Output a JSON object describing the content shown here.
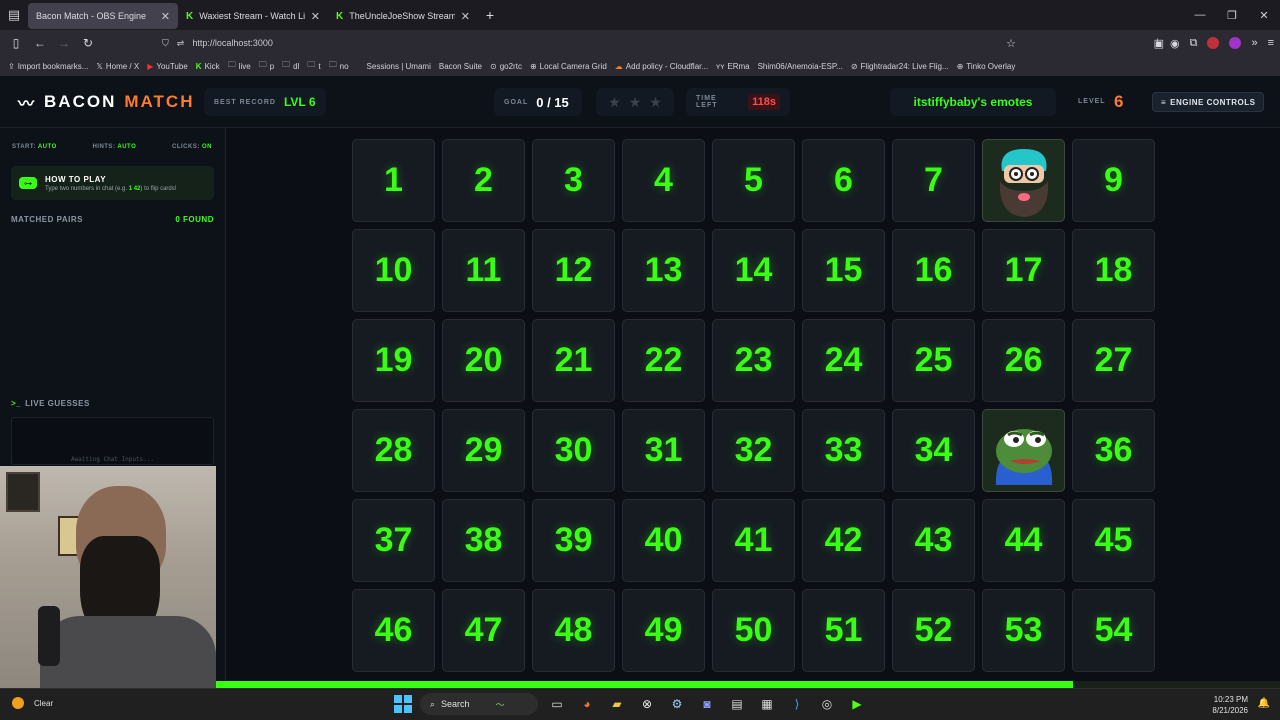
{
  "browser": {
    "tabs": [
      {
        "label": "Bacon Match - OBS Engine",
        "active": true
      },
      {
        "label": "Waxiest Stream - Watch Live on",
        "active": false
      },
      {
        "label": "TheUncleJoeShow Stream - ",
        "active": false
      }
    ],
    "url": "http://localhost:3000",
    "bookmarks": [
      "Import bookmarks...",
      "Home / X",
      "YouTube",
      "Kick",
      "live",
      "p",
      "dl",
      "t",
      "no",
      "Sessions | Umami",
      "Bacon Suite",
      "go2rtc",
      "Local Camera Grid",
      "Add policy - Cloudflar...",
      "ERma",
      "Shim06/Anemoia-ESP...",
      "Flightradar24: Live Flig...",
      "Tinko Overlay"
    ]
  },
  "header": {
    "logo_word1": "BACON",
    "logo_word2": "MATCH",
    "best_record_label": "BEST RECORD",
    "best_record_value": "LVL 6",
    "goal_label": "GOAL",
    "goal_value": "0 / 15",
    "stars_total": 3,
    "stars_filled": 0,
    "time_left_label": "TIME LEFT",
    "time_left_value": "118s",
    "emote_set_title": "itstiffybaby's emotes",
    "level_label": "LEVEL",
    "level_value": "6",
    "engine_controls_label": "ENGINE CONTROLS"
  },
  "sidebar": {
    "start_label": "START:",
    "start_value": "AUTO",
    "hints_label": "HINTS:",
    "hints_value": "AUTO",
    "clicks_label": "CLICKS:",
    "clicks_value": "ON",
    "howto_title": "HOW TO PLAY",
    "howto_text_prefix": "Type two numbers in chat (e.g.",
    "howto_example": "1 42",
    "howto_text_suffix": ") to flip cards!",
    "matched_label": "MATCHED PAIRS",
    "matched_value": "0 FOUND",
    "guesses_label": "LIVE GUESSES",
    "guesses_empty": "Awaiting Chat Inputs..."
  },
  "grid": {
    "columns": 9,
    "rows": 6,
    "revealed": {
      "8": "bearded-cartoon-emote",
      "35": "pepe-frog-emote"
    }
  },
  "timer_progress": 0.805,
  "taskbar": {
    "weather": "Clear",
    "search_placeholder": "Search",
    "time": "10:23 PM",
    "date": "8/21/2026"
  },
  "colors": {
    "accent_green": "#39ff14",
    "accent_orange": "#ff7a2e",
    "danger_red": "#ff4d4d"
  }
}
